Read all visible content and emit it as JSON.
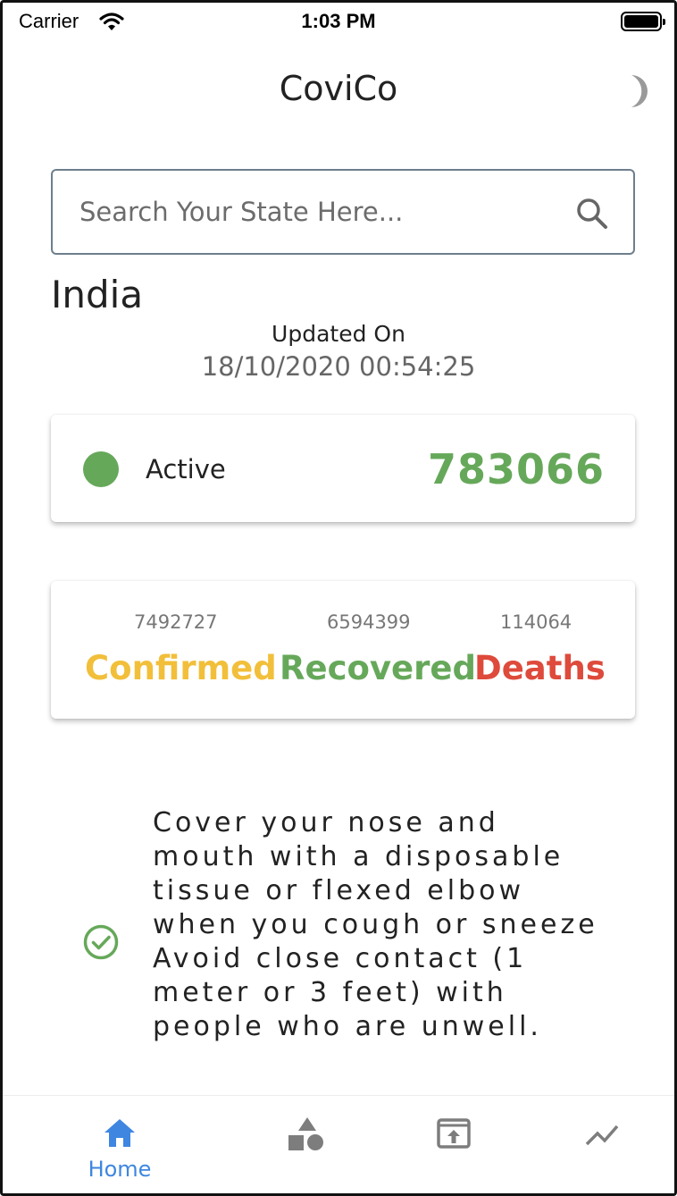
{
  "status_bar": {
    "carrier": "Carrier",
    "time": "1:03 PM"
  },
  "app_bar": {
    "title": "CoviCo",
    "theme_icon": "moon-icon"
  },
  "search": {
    "placeholder": "Search Your State Here...",
    "value": "",
    "icon": "search-icon"
  },
  "region": {
    "name": "India",
    "updated_label": "Updated On",
    "updated_value": "18/10/2020 00:54:25"
  },
  "active": {
    "label": "Active",
    "value": "783066",
    "color": "#66a85a"
  },
  "stats": {
    "confirmed": {
      "value": "7492727",
      "label": "Confirmed",
      "color": "#f2bf3a"
    },
    "recovered": {
      "value": "6594399",
      "label": "Recovered",
      "color": "#66a85a"
    },
    "deaths": {
      "value": "114064",
      "label": "Deaths",
      "color": "#de4a3b"
    }
  },
  "tip": {
    "icon": "check-circle-icon",
    "text": "Cover your nose and mouth with a disposable tissue or flexed elbow when you cough or sneeze Avoid close contact (1 meter or 3 feet) with people who are unwell."
  },
  "bottom_nav": {
    "active_color": "#3e86e0",
    "items": [
      {
        "icon": "home-icon",
        "label": "Home",
        "selected": true
      },
      {
        "icon": "shapes-icon",
        "label": "",
        "selected": false
      },
      {
        "icon": "open-in-browser-icon",
        "label": "",
        "selected": false
      },
      {
        "icon": "trending-up-icon",
        "label": "",
        "selected": false
      }
    ]
  }
}
